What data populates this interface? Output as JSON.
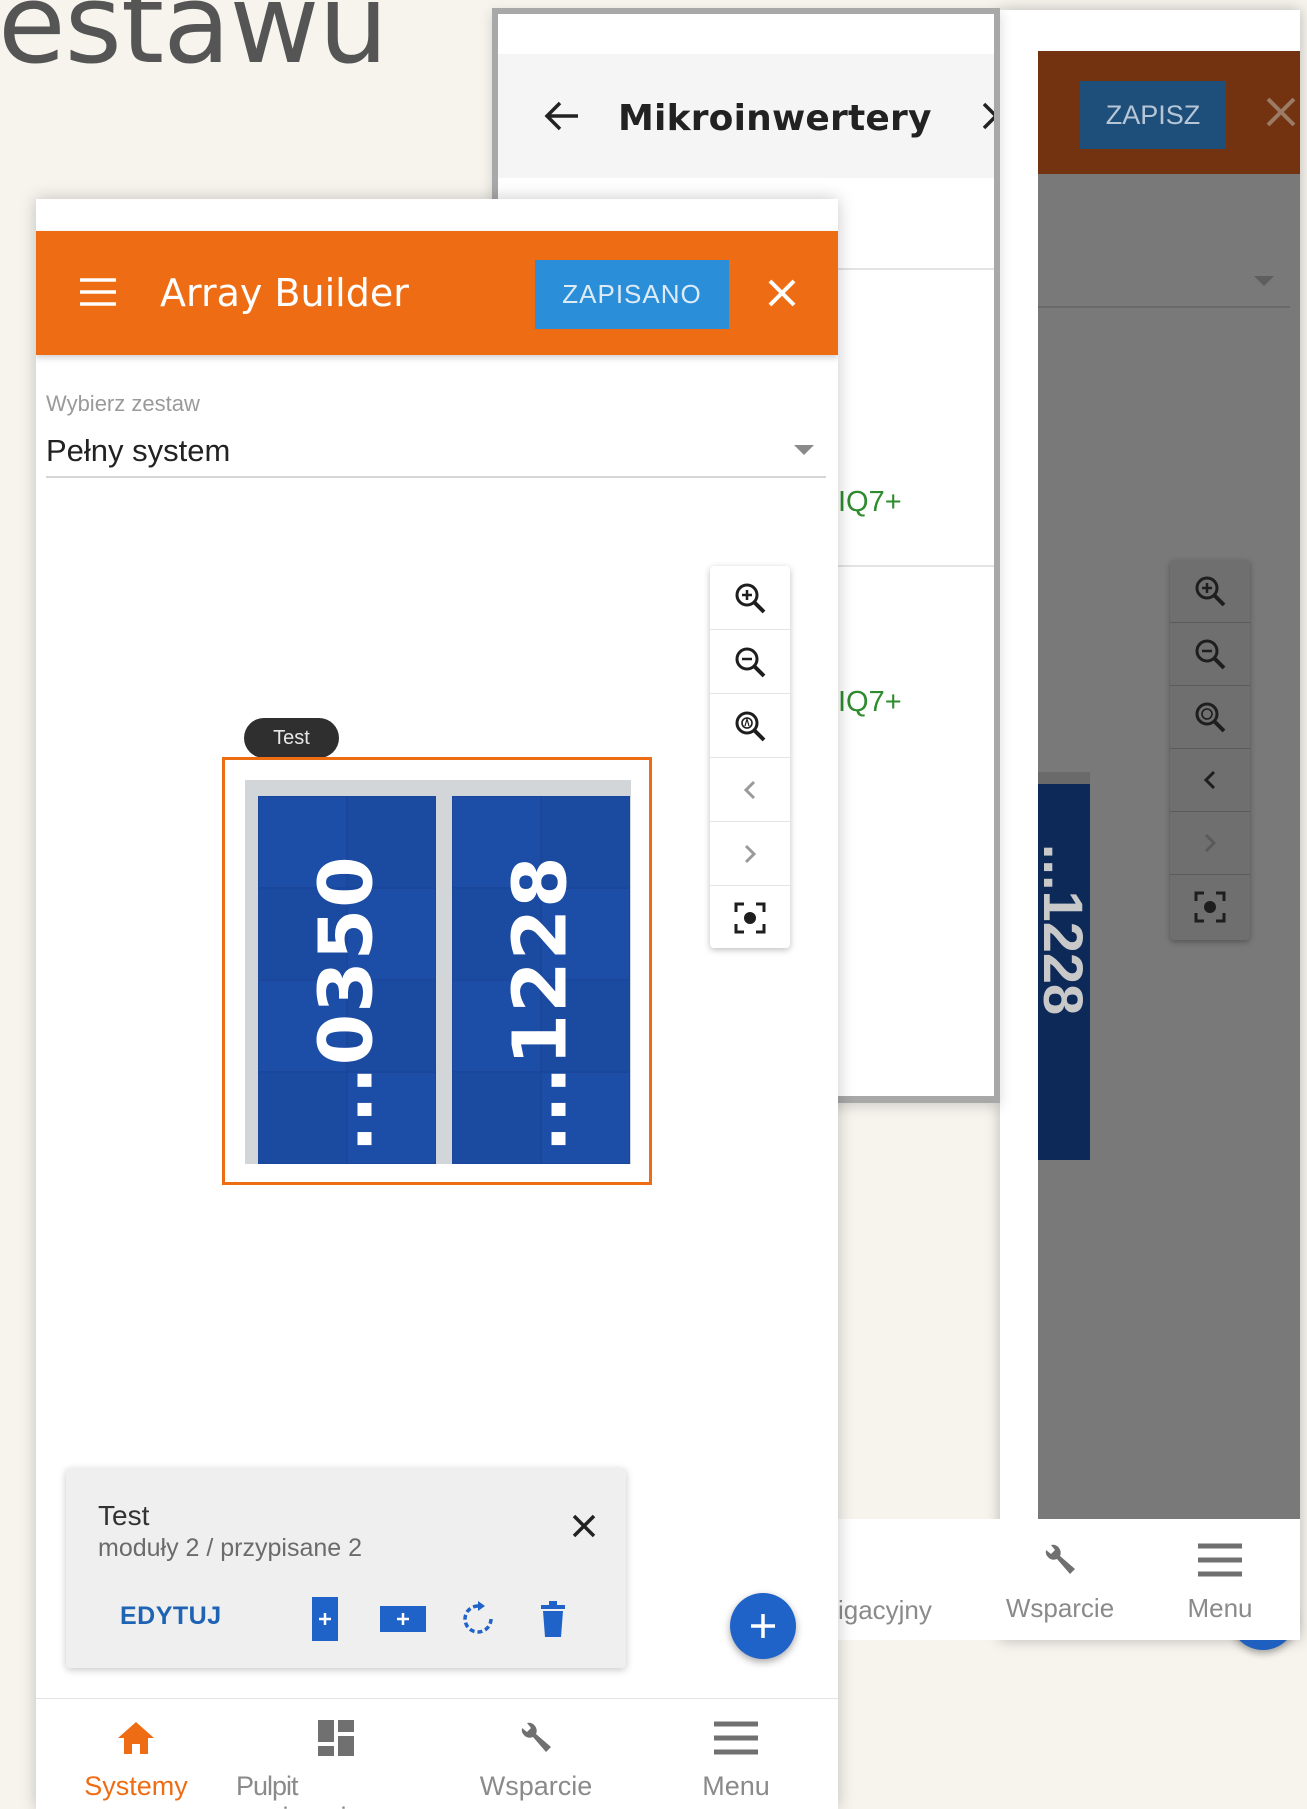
{
  "background": {
    "title_fragment": "estawu"
  },
  "back_screen": {
    "save_label": "ZAPISZ",
    "panel_number": "...1228",
    "nav": [
      {
        "label": "Pulpit nawigacyjny"
      },
      {
        "label": "Wsparcie"
      },
      {
        "label": "Menu"
      }
    ]
  },
  "mid_screen": {
    "title": "Mikroinwertery",
    "models": [
      "IQ7+",
      "IQ7+"
    ]
  },
  "header": {
    "title": "Array Builder",
    "save_label": "ZAPISANO"
  },
  "selector": {
    "label": "Wybierz zestaw",
    "value": "Pełny system"
  },
  "array": {
    "name": "Test",
    "panels": [
      {
        "number": "...0350"
      },
      {
        "number": "...1228"
      }
    ]
  },
  "card": {
    "title": "Test",
    "subtitle": "moduły 2 / przypisane 2",
    "edit_label": "EDYTUJ"
  },
  "bottom_nav": {
    "items": [
      {
        "label": "Systemy",
        "icon": "home-icon",
        "active": true
      },
      {
        "label": "Pulpit nawigacyjny",
        "icon": "dashboard-icon",
        "active": false
      },
      {
        "label": "Wsparcie",
        "icon": "wrench-icon",
        "active": false
      },
      {
        "label": "Menu",
        "icon": "menu-icon",
        "active": false
      }
    ]
  },
  "colors": {
    "accent": "#ee6d14",
    "save_button": "#2a8ed9",
    "panel_blue": "#1c4ea8",
    "fab_blue": "#1f63c9",
    "model_green": "#2e8b2e"
  }
}
